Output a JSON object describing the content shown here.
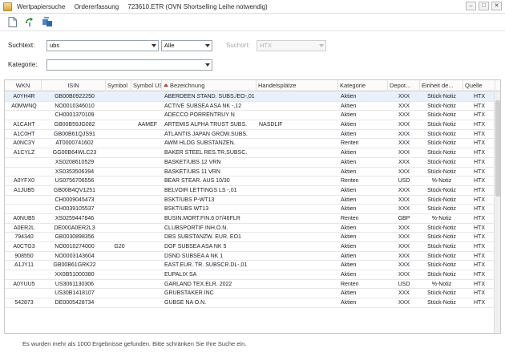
{
  "window": {
    "title_parts": [
      "Wertpapiersuche",
      "Ordererfassung",
      "723610.ETR (OVN Shortselling Leihe notwendig)"
    ],
    "buttons": [
      "–",
      "□",
      "✕"
    ]
  },
  "toolbar": {
    "icons": [
      "new-document-icon",
      "refresh-icon",
      "transfer-icon"
    ]
  },
  "search": {
    "term_label": "Suchtext:",
    "term_value": "ubs",
    "scope_value": "Alle",
    "source_label": "Suchort:",
    "source_value": "HTX",
    "category_label": "Kategorie:",
    "category_value": ""
  },
  "table": {
    "columns": [
      "WKN",
      "ISIN",
      "Symbol",
      "Symbol US",
      "Bezeichnung",
      "Handelsplätze",
      "Kategorie",
      "Depot...",
      "Einheit de...",
      "Quelle"
    ],
    "rows": [
      [
        "A0YH4R",
        "GB00B0922250",
        "",
        "",
        "ABERDEEN STAND. SUBS./EO-,01",
        "",
        "Aktien",
        "XXX",
        "Stück-Notiz",
        "HTX"
      ],
      [
        "A0MWNQ",
        "NO0010346010",
        "",
        "",
        "ACTIVE SUBSEA ASA NK -,12",
        "",
        "Aktien",
        "XXX",
        "Stück-Notiz",
        "HTX"
      ],
      [
        "",
        "CH0001370109",
        "",
        "",
        "ADECCO PORRENTRUY N",
        "",
        "Aktien",
        "XXX",
        "Stück-Notiz",
        "HTX"
      ],
      [
        "A1CAHT",
        "GB00B59JG082",
        "",
        "AAMEF",
        "ARTEMIS ALPHA TRUST SUBS.",
        "NASDLIF",
        "Aktien",
        "XXX",
        "Stück-Notiz",
        "HTX"
      ],
      [
        "A1C0HT",
        "GB00B61QJS91",
        "",
        "",
        "ATLANTIS JAPAN GROW.SUBS.",
        "",
        "Aktien",
        "XXX",
        "Stück-Notiz",
        "HTX"
      ],
      [
        "A0NC3Y",
        "AT0000741602",
        "",
        "",
        "AWM HLDG SUBSTANZEN.",
        "",
        "Renten",
        "XXX",
        "Stück-Notiz",
        "HTX"
      ],
      [
        "A1CYLZ",
        "GG00B64WLC23",
        "",
        "",
        "BAKER STEEL RES.TR.SUBSC.",
        "",
        "Aktien",
        "XXX",
        "Stück-Notiz",
        "HTX"
      ],
      [
        "",
        "XS0208610529",
        "",
        "",
        "BASKET/UBS 12 VRN",
        "",
        "Aktien",
        "XXX",
        "Stück-Notiz",
        "HTX"
      ],
      [
        "",
        "XS0353506394",
        "",
        "",
        "BASKET/UBS 11 VRN",
        "",
        "Aktien",
        "XXX",
        "Stück-Notiz",
        "HTX"
      ],
      [
        "A0YFX0",
        "US0756706556",
        "",
        "",
        "BEAR STEAR. AUS 10/30",
        "",
        "Renten",
        "USD",
        "%-Notiz",
        "HTX"
      ],
      [
        "A1JUB5",
        "GB00B4QV1251",
        "",
        "",
        "BELVOIR LETTINGS LS -,01",
        "",
        "Aktien",
        "XXX",
        "Stück-Notiz",
        "HTX"
      ],
      [
        "",
        "CH0009045473",
        "",
        "",
        "BSKT/UBS P-WT13",
        "",
        "Aktien",
        "XXX",
        "Stück-Notiz",
        "HTX"
      ],
      [
        "",
        "CH0039105537",
        "",
        "",
        "BSKT/UBS WT13",
        "",
        "Aktien",
        "XXX",
        "Stück-Notiz",
        "HTX"
      ],
      [
        "A0NUB5",
        "XS0259447846",
        "",
        "",
        "BUSIN.MORT.FIN.6 07/46FLR",
        "",
        "Renten",
        "GBP",
        "%-Notiz",
        "HTX"
      ],
      [
        "A0ER2L",
        "DE000A0ER2L3",
        "",
        "",
        "CLUBSPORTIF INH.O.N.",
        "",
        "Aktien",
        "XXX",
        "Stück-Notiz",
        "HTX"
      ],
      [
        "794340",
        "GB0030898356",
        "",
        "",
        "DBS SUBSTANZW. EUR. EO1",
        "",
        "Aktien",
        "XXX",
        "Stück-Notiz",
        "HTX"
      ],
      [
        "A0CTG3",
        "NO0010274000",
        "G20",
        "",
        "DOF SUBSEA ASA NK 5",
        "",
        "Aktien",
        "XXX",
        "Stück-Notiz",
        "HTX"
      ],
      [
        "908550",
        "NO0003143604",
        "",
        "",
        "DSND SUBSEA A NK 1",
        "",
        "Aktien",
        "XXX",
        "Stück-Notiz",
        "HTX"
      ],
      [
        "A1JY11",
        "GB00B61GRK22",
        "",
        "",
        "EAST.EUR. TR. SUBSCR.DL-,01",
        "",
        "Aktien",
        "XXX",
        "Stück-Notiz",
        "HTX"
      ],
      [
        "",
        "XX0B51000380",
        "",
        "",
        "EUPALIX SA",
        "",
        "Aktien",
        "XXX",
        "Stück-Notiz",
        "HTX"
      ],
      [
        "A0YUU5",
        "US3061130306",
        "",
        "",
        "GARLAND TEX.ELR. 2022",
        "",
        "Renten",
        "USD",
        "%-Notiz",
        "HTX"
      ],
      [
        "",
        "US30B1418107",
        "",
        "",
        "GRUBSTAKER INC",
        "",
        "Aktien",
        "XXX",
        "Stück-Notiz",
        "HTX"
      ],
      [
        "542873",
        "DE0005428734",
        "",
        "",
        "GUBSE NA O.N.",
        "",
        "Aktien",
        "XXX",
        "Stück-Notiz",
        "HTX"
      ]
    ]
  },
  "status": "Es wurden mehr als 1000 Ergebnisse gefunden. Bitte schränken Sie Ihre Suche ein."
}
